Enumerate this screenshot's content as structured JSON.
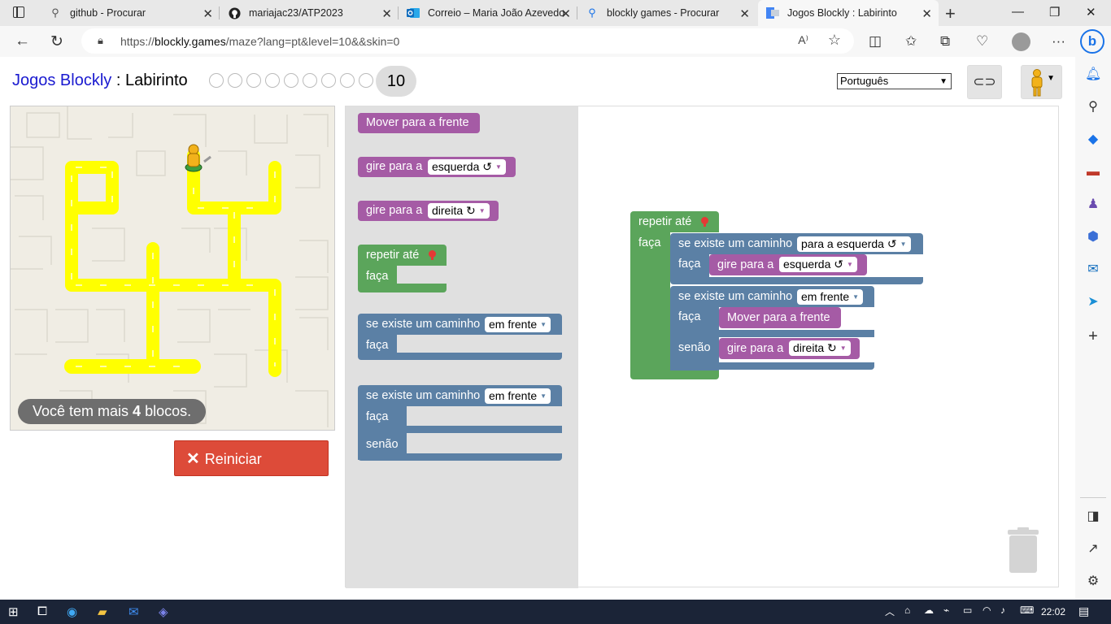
{
  "browser": {
    "tabs": [
      {
        "title": "github - Procurar",
        "icon": "search-icon",
        "active": false
      },
      {
        "title": "mariajac23/ATP2023",
        "icon": "github-icon",
        "active": false
      },
      {
        "title": "Correio – Maria João Azevedo",
        "icon": "outlook-icon",
        "active": false
      },
      {
        "title": "blockly games - Procurar",
        "icon": "search-icon",
        "active": false
      },
      {
        "title": "Jogos Blockly : Labirinto",
        "icon": "blockly-icon",
        "active": true
      }
    ],
    "url_prefix": "https://",
    "url_domain": "blockly.games",
    "url_path": "/maze?lang=pt&level=10&&skin=0"
  },
  "game": {
    "title_link": "Jogos Blockly",
    "title_sep": " : ",
    "title_name": "Labirinto",
    "current_level": "10",
    "language": "Português",
    "blocks_note_pre": "Você tem mais ",
    "blocks_note_num": "4",
    "blocks_note_post": " blocos.",
    "reset_label": "Reiniciar"
  },
  "toolbox": {
    "move": "Mover para a frente",
    "turn_left_label": "gire para a",
    "turn_left_value": "esquerda ↺",
    "turn_right_label": "gire para a",
    "turn_right_value": "direita ↻",
    "repeat_label": "repetir até",
    "repeat_do": "faça",
    "if_label": "se existe um caminho",
    "if_value": "em frente",
    "if_do": "faça",
    "ifelse_label": "se existe um caminho",
    "ifelse_value": "em frente",
    "ifelse_do": "faça",
    "ifelse_else": "senão"
  },
  "program": {
    "repeat_label": "repetir até",
    "repeat_do": "faça",
    "if1_label": "se existe um caminho",
    "if1_value": "para a esquerda ↺",
    "if1_do": "faça",
    "if1_turn_label": "gire para a",
    "if1_turn_value": "esquerda ↺",
    "if2_label": "se existe um caminho",
    "if2_value": "em frente",
    "if2_do": "faça",
    "if2_move": "Mover para a frente",
    "if2_else": "senão",
    "if2_turn_label": "gire para a",
    "if2_turn_value": "direita ↻"
  },
  "colors": {
    "motion_block": "#a55ba5",
    "loop_block": "#5ba55b",
    "logic_block": "#5b80a5",
    "reset_button": "#dd4b39",
    "maze_path": "#ffff00"
  },
  "system": {
    "time": "22:02"
  }
}
